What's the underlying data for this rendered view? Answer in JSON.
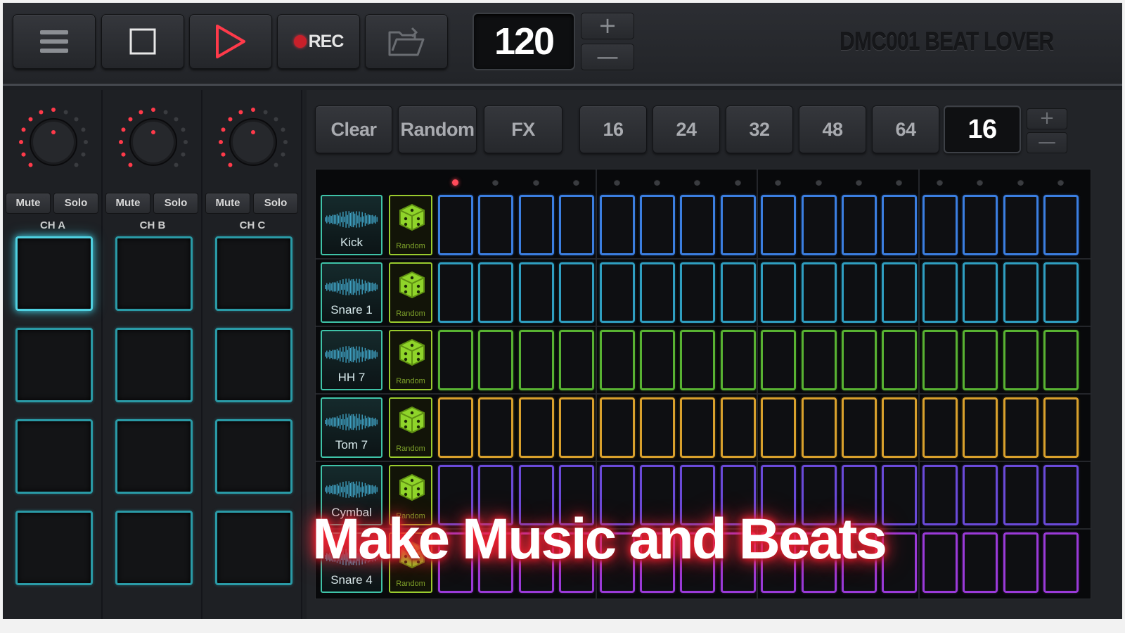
{
  "toolbar": {
    "menu_icon": "hamburger-menu-icon",
    "stop_icon": "stop-icon",
    "play_icon": "play-icon",
    "rec_label": "REC",
    "open_icon": "open-folder-icon",
    "bpm": "120",
    "plus": "+",
    "minus": "—",
    "app_title": "DMC001 BEAT LOVER"
  },
  "mixer": {
    "channels": [
      {
        "label": "CH A",
        "mute": "Mute",
        "solo": "Solo"
      },
      {
        "label": "CH B",
        "mute": "Mute",
        "solo": "Solo"
      },
      {
        "label": "CH C",
        "mute": "Mute",
        "solo": "Solo"
      }
    ]
  },
  "sequencer": {
    "clear": "Clear",
    "random": "Random",
    "fx": "FX",
    "step_options": [
      "16",
      "24",
      "32",
      "48",
      "64"
    ],
    "current_steps": "16",
    "plus": "+",
    "minus": "—",
    "tracks": [
      {
        "name": "Kick",
        "random_label": "Random",
        "color": "#3b7ee0"
      },
      {
        "name": "Snare 1",
        "random_label": "Random",
        "color": "#2f9ec0"
      },
      {
        "name": "HH 7",
        "random_label": "Random",
        "color": "#58b232"
      },
      {
        "name": "Tom 7",
        "random_label": "Random",
        "color": "#d8a02c"
      },
      {
        "name": "Cymbal",
        "random_label": "Random",
        "color": "#6a4ad8"
      },
      {
        "name": "Snare 4",
        "random_label": "Random",
        "color": "#9a3ad8"
      }
    ]
  },
  "caption": "Make Music and Beats",
  "colors": {
    "accent_red": "#ff2a3a",
    "pad_cyan": "#2a9aa6",
    "random_green": "#9acb2e"
  }
}
